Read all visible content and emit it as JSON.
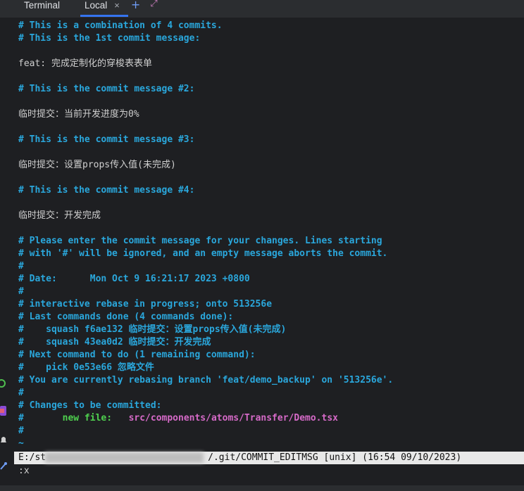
{
  "tabs": {
    "terminal_title": "Terminal",
    "local_tab": "Local",
    "close_glyph": "×",
    "add_glyph": "+",
    "expand_glyph": "⤢"
  },
  "lines": [
    {
      "t": "# This is a combination of 4 commits.",
      "s": "c"
    },
    {
      "t": "# This is the 1st commit message:",
      "s": "c"
    },
    {
      "t": "",
      "s": "w"
    },
    {
      "t": "feat: 完成定制化的穿梭表表单",
      "s": "w"
    },
    {
      "t": "",
      "s": "w"
    },
    {
      "t": "# This is the commit message #2:",
      "s": "c"
    },
    {
      "t": "",
      "s": "w"
    },
    {
      "t": "临时提交：当前开发进度为0%",
      "s": "w"
    },
    {
      "t": "",
      "s": "w"
    },
    {
      "t": "# This is the commit message #3:",
      "s": "c"
    },
    {
      "t": "",
      "s": "w"
    },
    {
      "t": "临时提交：设置props传入值(未完成)",
      "s": "w"
    },
    {
      "t": "",
      "s": "w"
    },
    {
      "t": "# This is the commit message #4:",
      "s": "c"
    },
    {
      "t": "",
      "s": "w"
    },
    {
      "t": "临时提交：开发完成",
      "s": "w"
    },
    {
      "t": "",
      "s": "w"
    },
    {
      "t": "# Please enter the commit message for your changes. Lines starting",
      "s": "c"
    },
    {
      "t": "# with '#' will be ignored, and an empty message aborts the commit.",
      "s": "c"
    },
    {
      "t": "#",
      "s": "c"
    },
    {
      "t": "# Date:      Mon Oct 9 16:21:17 2023 +0800",
      "s": "c"
    },
    {
      "t": "#",
      "s": "c"
    },
    {
      "t": "# interactive rebase in progress; onto 513256e",
      "s": "c"
    },
    {
      "t": "# Last commands done (4 commands done):",
      "s": "c"
    },
    {
      "t": "#    squash f6ae132 临时提交：设置props传入值(未完成)",
      "s": "c"
    },
    {
      "t": "#    squash 43ea0d2 临时提交：开发完成",
      "s": "c"
    },
    {
      "t": "# Next command to do (1 remaining command):",
      "s": "c"
    },
    {
      "t": "#    pick 0e53e66 忽略文件",
      "s": "c"
    },
    {
      "t": "# You are currently rebasing branch 'feat/demo_backup' on '513256e'.",
      "s": "c"
    },
    {
      "t": "#",
      "s": "c"
    },
    {
      "t": "# Changes to be committed:",
      "s": "c"
    },
    {
      "t": "#",
      "s": "c",
      "label": "new file:",
      "path": "src/components/atoms/Transfer/Demo.tsx"
    },
    {
      "t": "#",
      "s": "c"
    },
    {
      "t": "~",
      "s": "c"
    }
  ],
  "status_line": {
    "prefix": "E:/st",
    "suffix": "/.git/COMMIT_EDITMSG [unix] (16:54 09/10/2023)"
  },
  "command_line": ":x",
  "gutter_icons": [
    "gear-icon",
    "plugin-icon",
    "notification-icon",
    "git-icon"
  ]
}
